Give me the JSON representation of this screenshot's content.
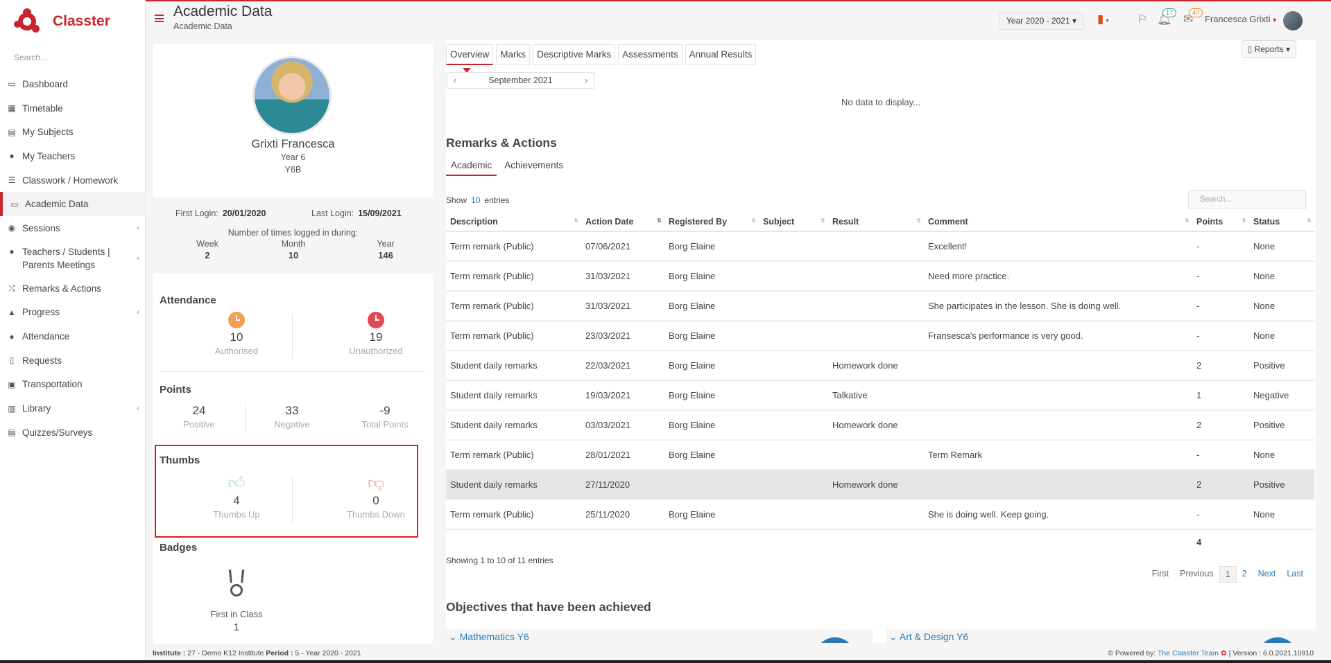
{
  "app": {
    "name": "Classter",
    "search_placeholder": "Search..."
  },
  "sidebar": {
    "items": [
      {
        "label": "Dashboard",
        "icon": "laptop-icon"
      },
      {
        "label": "Timetable",
        "icon": "calendar-icon"
      },
      {
        "label": "My Subjects",
        "icon": "book-icon"
      },
      {
        "label": "My Teachers",
        "icon": "teachers-icon"
      },
      {
        "label": "Classwork / Homework",
        "icon": "list-icon"
      },
      {
        "label": "Academic Data",
        "icon": "id-card-icon"
      },
      {
        "label": "Sessions",
        "icon": "sessions-icon"
      },
      {
        "label": "Teachers / Students | Parents Meetings",
        "icon": "meeting-icon"
      },
      {
        "label": "Remarks & Actions",
        "icon": "remarks-icon"
      },
      {
        "label": "Progress",
        "icon": "graduation-cap-icon"
      },
      {
        "label": "Attendance",
        "icon": "attendance-icon"
      },
      {
        "label": "Requests",
        "icon": "file-icon"
      },
      {
        "label": "Transportation",
        "icon": "bus-icon"
      },
      {
        "label": "Library",
        "icon": "library-icon"
      },
      {
        "label": "Quizzes/Surveys",
        "icon": "quiz-icon"
      }
    ]
  },
  "header": {
    "title": "Academic Data",
    "breadcrumb": "Academic Data",
    "year": "Year 2020 - 2021",
    "notifications_count": "17",
    "messages_count": "43",
    "user_name": "Francesca Grixti"
  },
  "profile": {
    "name": "Grixti Francesca",
    "year": "Year 6",
    "class": "Y6B",
    "first_login_label": "First Login:",
    "first_login": "20/01/2020",
    "last_login_label": "Last Login:",
    "last_login": "15/09/2021",
    "times_label": "Number of times logged in during:",
    "week_label": "Week",
    "week": "2",
    "month_label": "Month",
    "month": "10",
    "year_label": "Year",
    "year_count": "146"
  },
  "attendance": {
    "title": "Attendance",
    "authorised": "10",
    "authorised_label": "Authorised",
    "unauthorized": "19",
    "unauthorized_label": "Unauthorized",
    "authorised_color": "#f0a050",
    "unauthorized_color": "#e04a55"
  },
  "points": {
    "title": "Points",
    "positive": "24",
    "positive_label": "Positive",
    "negative": "33",
    "negative_label": "Negative",
    "total": "-9",
    "total_label": "Total Points"
  },
  "thumbs": {
    "title": "Thumbs",
    "up": "4",
    "up_label": "Thumbs Up",
    "down": "0",
    "down_label": "Thumbs Down"
  },
  "badges": {
    "title": "Badges",
    "items": [
      {
        "label": "First in Class",
        "count": "1"
      }
    ]
  },
  "main": {
    "tabs": [
      "Overview",
      "Marks",
      "Descriptive Marks",
      "Assessments",
      "Annual Results"
    ],
    "reports_label": "Reports",
    "month": "September 2021",
    "no_data": "No data to display...",
    "remarks_title": "Remarks & Actions",
    "subtabs": [
      "Academic",
      "Achievements"
    ],
    "show_label": "Show",
    "show_value": "10",
    "entries_label": "entries",
    "search_placeholder": "Search...",
    "columns": [
      "Description",
      "Action Date",
      "Registered By",
      "Subject",
      "Result",
      "Comment",
      "Points",
      "Status"
    ],
    "rows": [
      [
        "Term remark (Public)",
        "07/06/2021",
        "Borg Elaine",
        "",
        "",
        "Excellent!",
        "-",
        "None"
      ],
      [
        "Term remark (Public)",
        "31/03/2021",
        "Borg Elaine",
        "",
        "",
        "Need more practice.",
        "-",
        "None"
      ],
      [
        "Term remark (Public)",
        "31/03/2021",
        "Borg Elaine",
        "",
        "",
        "She participates in the lesson. She is doing well.",
        "-",
        "None"
      ],
      [
        "Term remark (Public)",
        "23/03/2021",
        "Borg Elaine",
        "",
        "",
        "Fransesca's performance is very good.",
        "-",
        "None"
      ],
      [
        "Student daily remarks",
        "22/03/2021",
        "Borg Elaine",
        "",
        "Homework done",
        "",
        "2",
        "Positive"
      ],
      [
        "Student daily remarks",
        "19/03/2021",
        "Borg Elaine",
        "",
        "Talkative",
        "",
        "1",
        "Negative"
      ],
      [
        "Student daily remarks",
        "03/03/2021",
        "Borg Elaine",
        "",
        "Homework done",
        "",
        "2",
        "Positive"
      ],
      [
        "Term remark (Public)",
        "28/01/2021",
        "Borg Elaine",
        "",
        "",
        "Term Remark",
        "-",
        "None"
      ],
      [
        "Student daily remarks",
        "27/11/2020",
        "",
        "",
        "Homework done",
        "",
        "2",
        "Positive"
      ],
      [
        "Term remark (Public)",
        "25/11/2020",
        "Borg Elaine",
        "",
        "",
        "She is doing well. Keep going.",
        "-",
        "None"
      ]
    ],
    "points_total": "4",
    "showing": "Showing 1 to 10 of 11 entries",
    "pager": [
      "First",
      "Previous",
      "1",
      "2",
      "Next",
      "Last"
    ],
    "objectives_title": "Objectives that have been achieved",
    "objectives": [
      "Mathematics Y6",
      "Art & Design Y6"
    ]
  },
  "footer": {
    "institute_label": "Institute :",
    "institute": "27 - Demo K12 Institute",
    "period_label": "Period :",
    "period": "5 - Year 2020 - 2021",
    "powered_label": "Powered by:",
    "powered_by": "The Classter Team",
    "version": "| Version : 6.0.2021.10910"
  },
  "colors": {
    "brand": "#c9252c",
    "link": "#2a7ab8",
    "highlight_border": "#e01b1b"
  }
}
